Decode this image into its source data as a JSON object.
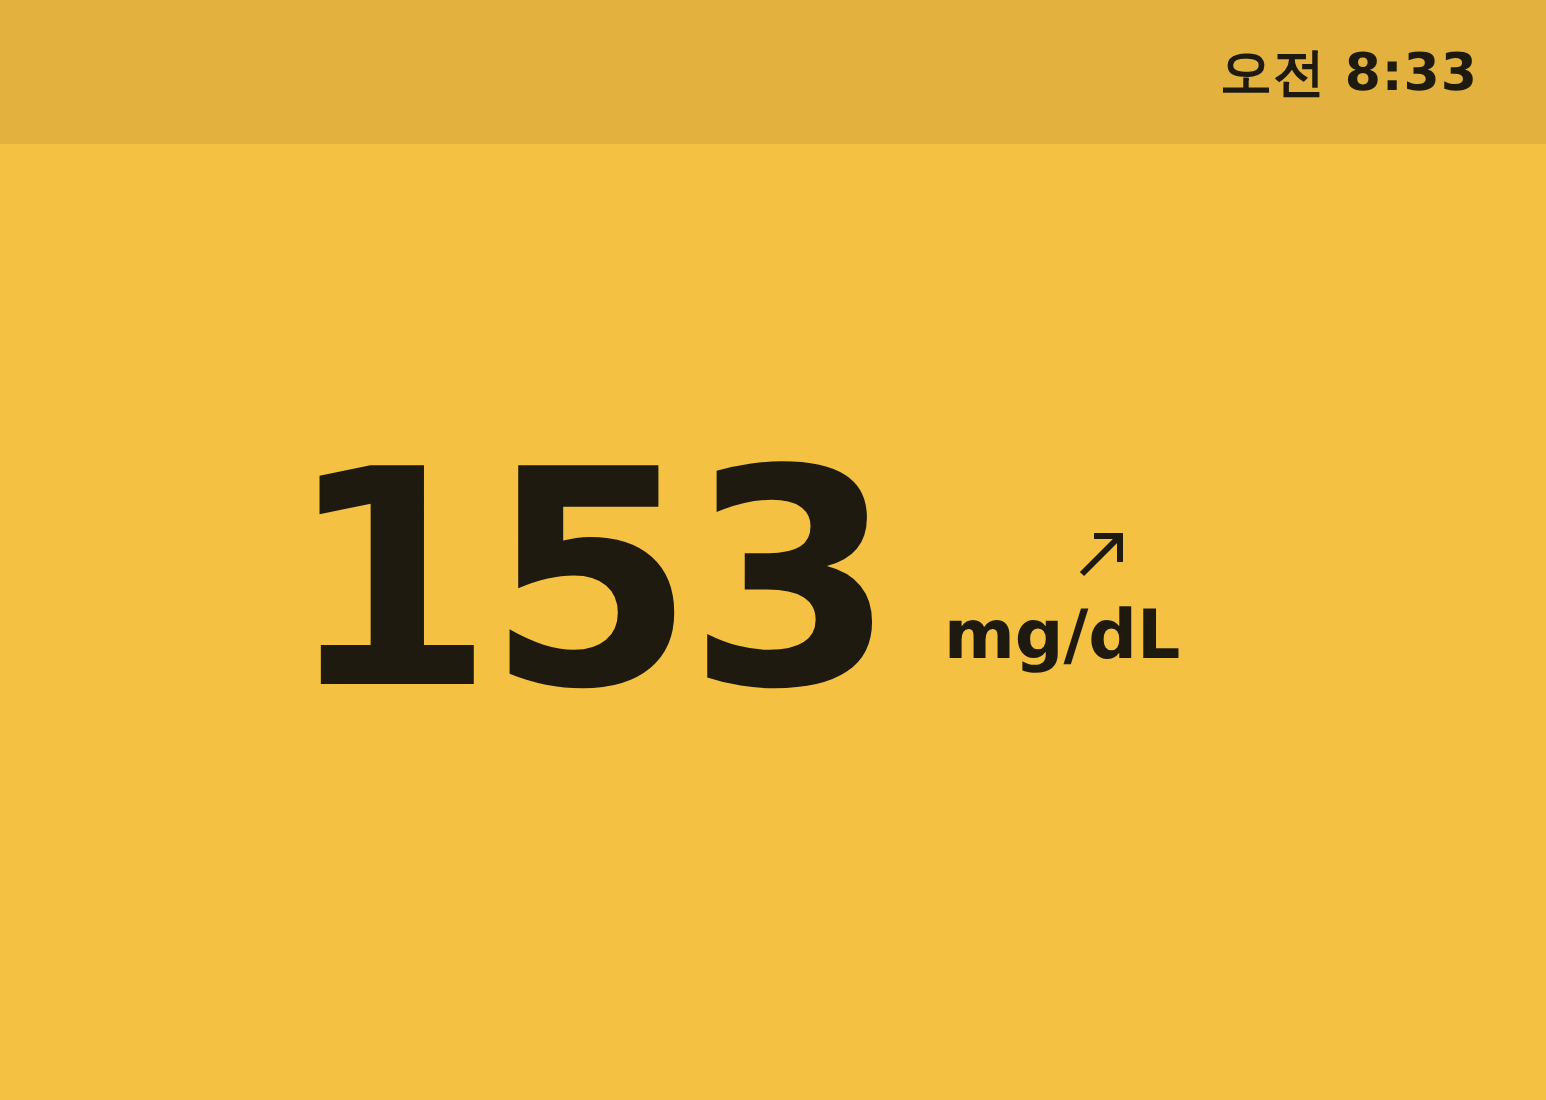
{
  "status_bar": {
    "time": "오전 8:33"
  },
  "reading": {
    "value": "153",
    "unit": "mg/dL"
  }
}
